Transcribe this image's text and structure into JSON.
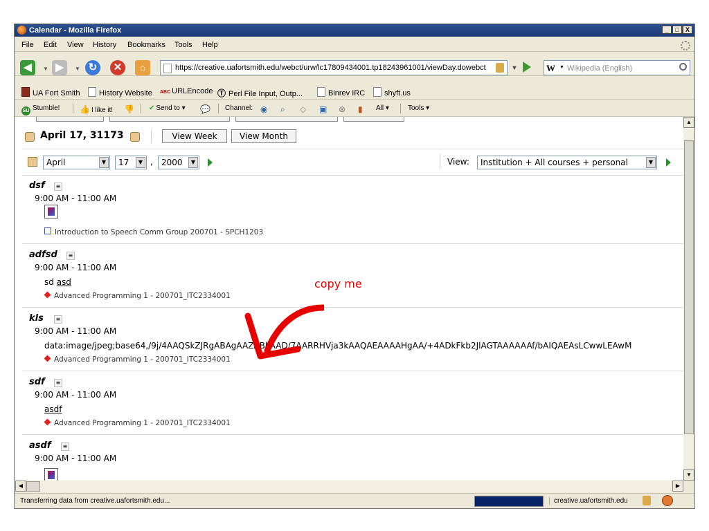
{
  "window": {
    "title": "Calendar - Mozilla Firefox",
    "min": "_",
    "max": "□",
    "close": "X"
  },
  "menu": [
    "File",
    "Edit",
    "View",
    "History",
    "Bookmarks",
    "Tools",
    "Help"
  ],
  "nav": {
    "url": "https://creative.uafortsmith.edu/webct/urw/lc17809434001.tp18243961001/viewDay.dowebct",
    "search_engine": "W",
    "search_placeholder": "Wikipedia (English)"
  },
  "bookmarks": [
    "UA Fort Smith",
    "History Website",
    "URLEncode",
    "Perl File Input, Outp...",
    "Binrev IRC",
    "shyft.us"
  ],
  "stumble": {
    "stumble": "Stumble!",
    "like": "I like it!",
    "send": "Send to",
    "channel": "Channel:",
    "all": "All",
    "tools": "Tools"
  },
  "calendar": {
    "date_title": "April 17, 31173",
    "view_week": "View Week",
    "view_month": "View Month",
    "month": "April",
    "day": "17",
    "comma": ",",
    "year": "2000",
    "view_label": "View:",
    "view_value": "Institution + All courses + personal"
  },
  "entries": [
    {
      "name": "dsf",
      "time": "9:00 AM - 11:00 AM",
      "course": "Introduction to Speech Comm Group 200701 - SPCH1203"
    },
    {
      "name": "adfsd",
      "time": "9:00 AM - 11:00 AM",
      "body_plain": "sd ",
      "body_link": "asd",
      "course": "Advanced Programming 1 - 200701_ITC2334001"
    },
    {
      "name": "kls",
      "time": "9:00 AM - 11:00 AM",
      "body_plain": "data:image/jpeg;base64,/9j/4AAQSkZJRgABAgAAZABkAAD/7AARRHVja3kAAQAEAAAAHgAA/+4ADkFkb2JlAGTAAAAAAf/bAIQAEAsLCwwLEAwM",
      "course": "Advanced Programming 1 - 200701_ITC2334001"
    },
    {
      "name": "sdf",
      "time": "9:00 AM - 11:00 AM",
      "body_link": "asdf",
      "course": "Advanced Programming 1 - 200701_ITC2334001"
    },
    {
      "name": "asdf",
      "time": "9:00 AM - 11:00 AM"
    }
  ],
  "annotation": "copy me",
  "status": {
    "text": "Transferring data from creative.uafortsmith.edu...",
    "host": "creative.uafortsmith.edu",
    "progress": 1.0
  },
  "colors": {
    "annotation": "#e60000",
    "titlebar": "#1c3a75",
    "progress": "#0a246a"
  }
}
